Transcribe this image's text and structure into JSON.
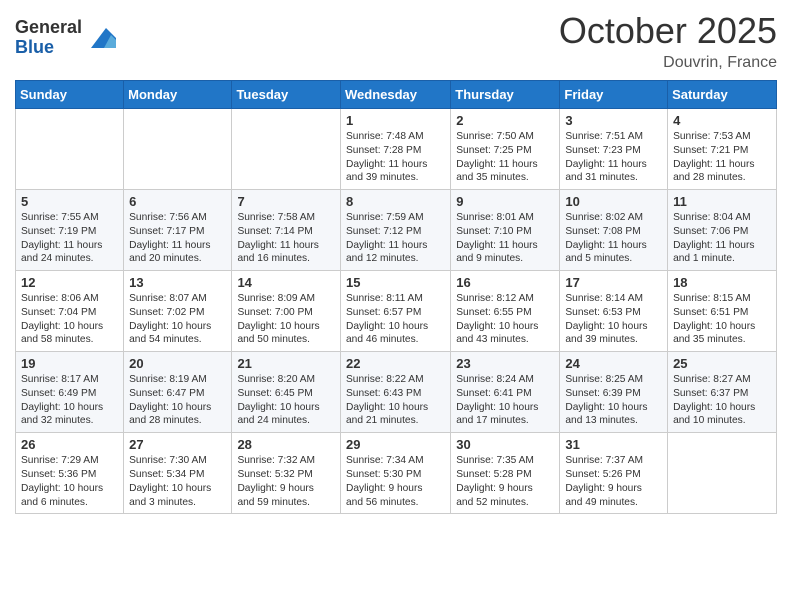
{
  "header": {
    "logo_general": "General",
    "logo_blue": "Blue",
    "month": "October 2025",
    "location": "Douvrin, France"
  },
  "weekdays": [
    "Sunday",
    "Monday",
    "Tuesday",
    "Wednesday",
    "Thursday",
    "Friday",
    "Saturday"
  ],
  "weeks": [
    [
      {
        "day": "",
        "content": ""
      },
      {
        "day": "",
        "content": ""
      },
      {
        "day": "",
        "content": ""
      },
      {
        "day": "1",
        "content": "Sunrise: 7:48 AM\nSunset: 7:28 PM\nDaylight: 11 hours\nand 39 minutes."
      },
      {
        "day": "2",
        "content": "Sunrise: 7:50 AM\nSunset: 7:25 PM\nDaylight: 11 hours\nand 35 minutes."
      },
      {
        "day": "3",
        "content": "Sunrise: 7:51 AM\nSunset: 7:23 PM\nDaylight: 11 hours\nand 31 minutes."
      },
      {
        "day": "4",
        "content": "Sunrise: 7:53 AM\nSunset: 7:21 PM\nDaylight: 11 hours\nand 28 minutes."
      }
    ],
    [
      {
        "day": "5",
        "content": "Sunrise: 7:55 AM\nSunset: 7:19 PM\nDaylight: 11 hours\nand 24 minutes."
      },
      {
        "day": "6",
        "content": "Sunrise: 7:56 AM\nSunset: 7:17 PM\nDaylight: 11 hours\nand 20 minutes."
      },
      {
        "day": "7",
        "content": "Sunrise: 7:58 AM\nSunset: 7:14 PM\nDaylight: 11 hours\nand 16 minutes."
      },
      {
        "day": "8",
        "content": "Sunrise: 7:59 AM\nSunset: 7:12 PM\nDaylight: 11 hours\nand 12 minutes."
      },
      {
        "day": "9",
        "content": "Sunrise: 8:01 AM\nSunset: 7:10 PM\nDaylight: 11 hours\nand 9 minutes."
      },
      {
        "day": "10",
        "content": "Sunrise: 8:02 AM\nSunset: 7:08 PM\nDaylight: 11 hours\nand 5 minutes."
      },
      {
        "day": "11",
        "content": "Sunrise: 8:04 AM\nSunset: 7:06 PM\nDaylight: 11 hours\nand 1 minute."
      }
    ],
    [
      {
        "day": "12",
        "content": "Sunrise: 8:06 AM\nSunset: 7:04 PM\nDaylight: 10 hours\nand 58 minutes."
      },
      {
        "day": "13",
        "content": "Sunrise: 8:07 AM\nSunset: 7:02 PM\nDaylight: 10 hours\nand 54 minutes."
      },
      {
        "day": "14",
        "content": "Sunrise: 8:09 AM\nSunset: 7:00 PM\nDaylight: 10 hours\nand 50 minutes."
      },
      {
        "day": "15",
        "content": "Sunrise: 8:11 AM\nSunset: 6:57 PM\nDaylight: 10 hours\nand 46 minutes."
      },
      {
        "day": "16",
        "content": "Sunrise: 8:12 AM\nSunset: 6:55 PM\nDaylight: 10 hours\nand 43 minutes."
      },
      {
        "day": "17",
        "content": "Sunrise: 8:14 AM\nSunset: 6:53 PM\nDaylight: 10 hours\nand 39 minutes."
      },
      {
        "day": "18",
        "content": "Sunrise: 8:15 AM\nSunset: 6:51 PM\nDaylight: 10 hours\nand 35 minutes."
      }
    ],
    [
      {
        "day": "19",
        "content": "Sunrise: 8:17 AM\nSunset: 6:49 PM\nDaylight: 10 hours\nand 32 minutes."
      },
      {
        "day": "20",
        "content": "Sunrise: 8:19 AM\nSunset: 6:47 PM\nDaylight: 10 hours\nand 28 minutes."
      },
      {
        "day": "21",
        "content": "Sunrise: 8:20 AM\nSunset: 6:45 PM\nDaylight: 10 hours\nand 24 minutes."
      },
      {
        "day": "22",
        "content": "Sunrise: 8:22 AM\nSunset: 6:43 PM\nDaylight: 10 hours\nand 21 minutes."
      },
      {
        "day": "23",
        "content": "Sunrise: 8:24 AM\nSunset: 6:41 PM\nDaylight: 10 hours\nand 17 minutes."
      },
      {
        "day": "24",
        "content": "Sunrise: 8:25 AM\nSunset: 6:39 PM\nDaylight: 10 hours\nand 13 minutes."
      },
      {
        "day": "25",
        "content": "Sunrise: 8:27 AM\nSunset: 6:37 PM\nDaylight: 10 hours\nand 10 minutes."
      }
    ],
    [
      {
        "day": "26",
        "content": "Sunrise: 7:29 AM\nSunset: 5:36 PM\nDaylight: 10 hours\nand 6 minutes."
      },
      {
        "day": "27",
        "content": "Sunrise: 7:30 AM\nSunset: 5:34 PM\nDaylight: 10 hours\nand 3 minutes."
      },
      {
        "day": "28",
        "content": "Sunrise: 7:32 AM\nSunset: 5:32 PM\nDaylight: 9 hours\nand 59 minutes."
      },
      {
        "day": "29",
        "content": "Sunrise: 7:34 AM\nSunset: 5:30 PM\nDaylight: 9 hours\nand 56 minutes."
      },
      {
        "day": "30",
        "content": "Sunrise: 7:35 AM\nSunset: 5:28 PM\nDaylight: 9 hours\nand 52 minutes."
      },
      {
        "day": "31",
        "content": "Sunrise: 7:37 AM\nSunset: 5:26 PM\nDaylight: 9 hours\nand 49 minutes."
      },
      {
        "day": "",
        "content": ""
      }
    ]
  ]
}
